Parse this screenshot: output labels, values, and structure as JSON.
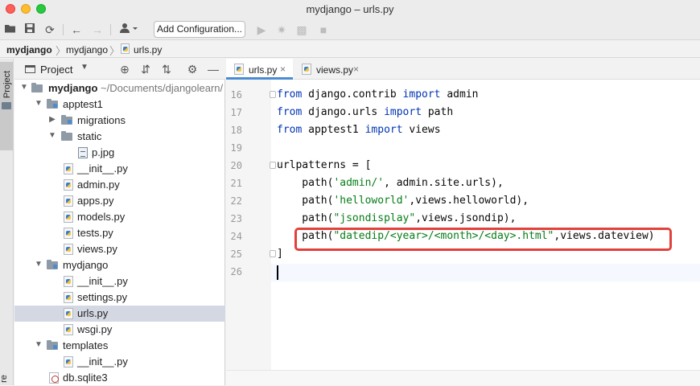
{
  "window": {
    "title": "mydjango – urls.py"
  },
  "toolbar": {
    "add_config_label": "Add Configuration...",
    "icons": [
      "folder-open-icon",
      "save-icon",
      "sync-icon",
      "back-icon",
      "forward-icon",
      "user-icon",
      "run-icon",
      "debug-icon",
      "coverage-icon",
      "stop-icon"
    ]
  },
  "breadcrumb": {
    "items": [
      "mydjango",
      "mydjango",
      "urls.py"
    ]
  },
  "side_strip": {
    "project_label": "Project",
    "bottom_label": "re"
  },
  "project_panel": {
    "title": "Project",
    "root": {
      "name": "mydjango",
      "path": "~/Documents/djangolearn/"
    },
    "items": [
      {
        "name": "apptest1"
      },
      {
        "name": "migrations"
      },
      {
        "name": "static"
      },
      {
        "name": "p.jpg"
      },
      {
        "name": "__init__.py"
      },
      {
        "name": "admin.py"
      },
      {
        "name": "apps.py"
      },
      {
        "name": "models.py"
      },
      {
        "name": "tests.py"
      },
      {
        "name": "views.py"
      },
      {
        "name": "mydjango"
      },
      {
        "name": "__init__.py"
      },
      {
        "name": "settings.py"
      },
      {
        "name": "urls.py"
      },
      {
        "name": "wsgi.py"
      },
      {
        "name": "templates"
      },
      {
        "name": "__init__.py"
      },
      {
        "name": "db.sqlite3"
      }
    ]
  },
  "editor": {
    "tabs": [
      {
        "label": "urls.py",
        "active": true
      },
      {
        "label": "views.py",
        "active": false
      }
    ],
    "line_numbers": [
      "16",
      "17",
      "18",
      "19",
      "20",
      "21",
      "22",
      "23",
      "24",
      "25",
      "26"
    ],
    "code": {
      "l16": {
        "kw1": "from",
        "mod": " django.contrib ",
        "kw2": "import",
        "rest": " admin"
      },
      "l17": {
        "kw1": "from",
        "mod": " django.urls ",
        "kw2": "import",
        "rest": " path"
      },
      "l18": {
        "kw1": "from",
        "mod": " apptest1 ",
        "kw2": "import",
        "rest": " views"
      },
      "l20": {
        "text": "urlpatterns = ["
      },
      "l21": {
        "pre": "    path(",
        "str": "'admin/'",
        "post": ", admin.site.urls),"
      },
      "l22": {
        "pre": "    path(",
        "str": "'helloworld'",
        "post": ",views.helloworld),"
      },
      "l23": {
        "pre": "    path(",
        "str": "\"jsondisplay\"",
        "post": ",views.jsondip),"
      },
      "l24": {
        "pre": "    path(",
        "str": "\"datedip/<year>/<month>/<day>.html\"",
        "post": ",views.dateview)"
      },
      "l25": {
        "text": "]"
      }
    },
    "highlight_color": "#e2413b"
  }
}
